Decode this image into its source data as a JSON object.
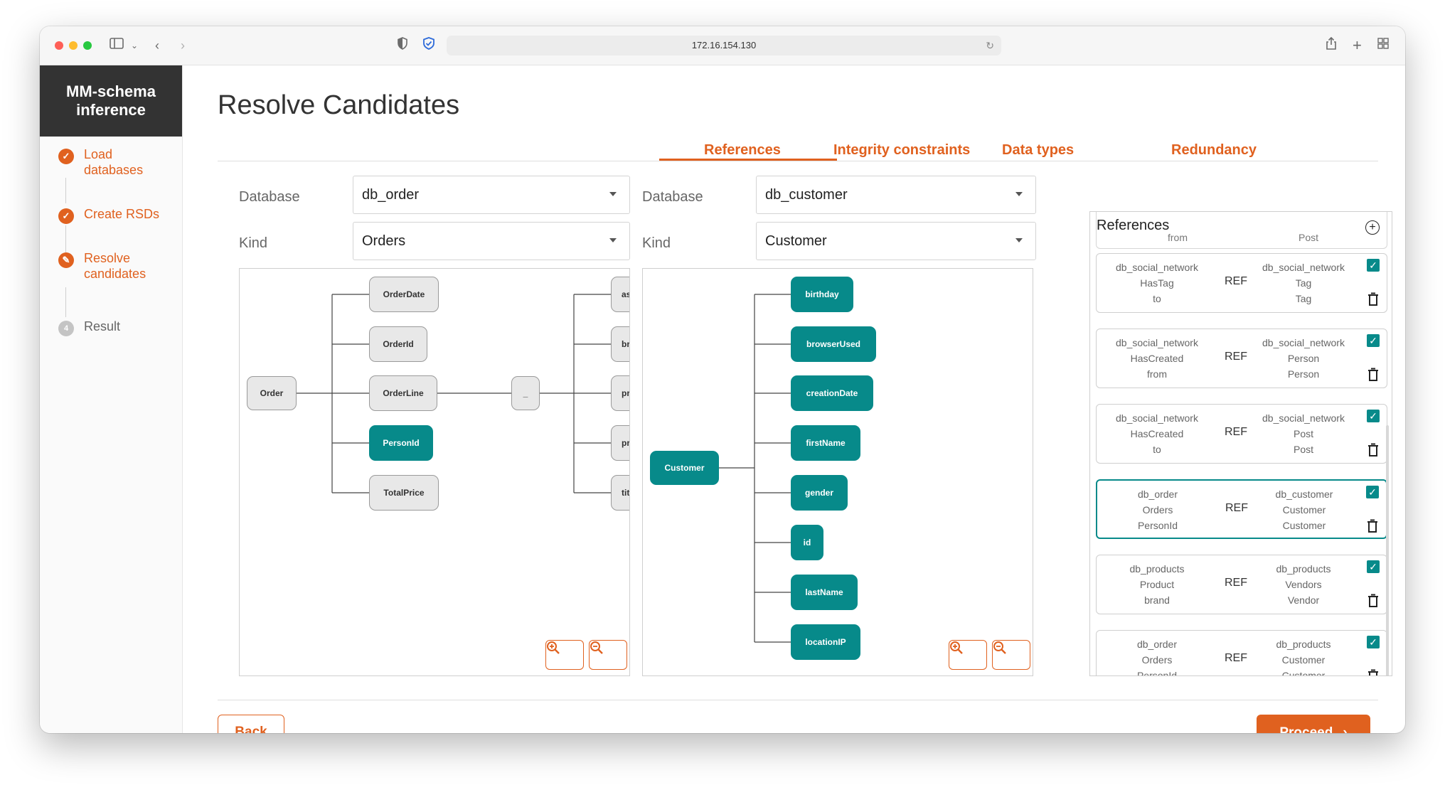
{
  "browser": {
    "url": "172.16.154.130"
  },
  "sidebar": {
    "brand": "MM-schema inference",
    "steps": [
      {
        "label": "Load databases",
        "state": "done",
        "icon": "check-icon"
      },
      {
        "label": "Create RSDs",
        "state": "done",
        "icon": "check-icon"
      },
      {
        "label": "Resolve candidates",
        "state": "active",
        "icon": "pencil-icon"
      },
      {
        "label": "Result",
        "state": "todo",
        "number": "4"
      }
    ]
  },
  "page": {
    "title": "Resolve Candidates"
  },
  "tabs": [
    {
      "label": "References",
      "active": true
    },
    {
      "label": "Integrity constraints",
      "active": false
    },
    {
      "label": "Data types",
      "active": false
    },
    {
      "label": "Redundancy",
      "active": false
    }
  ],
  "left": {
    "database_label": "Database",
    "database_value": "db_order",
    "kind_label": "Kind",
    "kind_value": "Orders"
  },
  "right": {
    "database_label": "Database",
    "database_value": "db_customer",
    "kind_label": "Kind",
    "kind_value": "Customer"
  },
  "left_graph": {
    "root": "Order",
    "children": [
      "OrderDate",
      "OrderId",
      "OrderLine",
      "PersonId",
      "TotalPrice"
    ],
    "highlighted": [
      "PersonId"
    ],
    "mid": "_",
    "partial": [
      "as",
      "br",
      "pr",
      "pr",
      "tit"
    ]
  },
  "right_graph": {
    "root": "Customer",
    "children": [
      "birthday",
      "browserUsed",
      "creationDate",
      "firstName",
      "gender",
      "id",
      "lastName",
      "locationIP"
    ]
  },
  "references": {
    "title": "References",
    "ghost_left": "from",
    "ghost_right": "Post",
    "ref_label": "REF",
    "items": [
      {
        "left": [
          "db_social_network",
          "HasTag",
          "to"
        ],
        "right": [
          "db_social_network",
          "Tag",
          "Tag"
        ],
        "checked": true,
        "selected": false
      },
      {
        "left": [
          "db_social_network",
          "HasCreated",
          "from"
        ],
        "right": [
          "db_social_network",
          "Person",
          "Person"
        ],
        "checked": true,
        "selected": false
      },
      {
        "left": [
          "db_social_network",
          "HasCreated",
          "to"
        ],
        "right": [
          "db_social_network",
          "Post",
          "Post"
        ],
        "checked": true,
        "selected": false
      },
      {
        "left": [
          "db_order",
          "Orders",
          "PersonId"
        ],
        "right": [
          "db_customer",
          "Customer",
          "Customer"
        ],
        "checked": true,
        "selected": true
      },
      {
        "left": [
          "db_products",
          "Product",
          "brand"
        ],
        "right": [
          "db_products",
          "Vendors",
          "Vendor"
        ],
        "checked": true,
        "selected": false
      },
      {
        "left": [
          "db_order",
          "Orders",
          "PersonId"
        ],
        "right": [
          "db_products",
          "Customer",
          "Customer"
        ],
        "checked": true,
        "selected": false
      }
    ]
  },
  "actions": {
    "back": "Back",
    "proceed": "Proceed"
  },
  "colors": {
    "accent": "#e0611f",
    "teal": "#078a8a",
    "brand_bg": "#333333"
  }
}
